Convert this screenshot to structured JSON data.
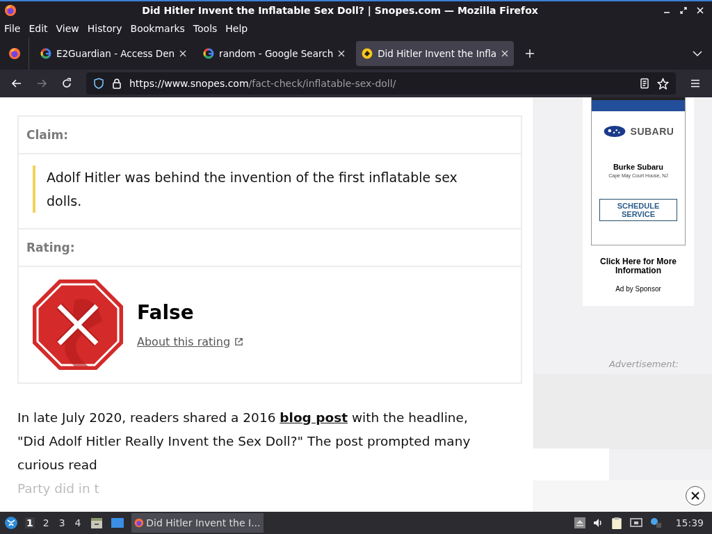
{
  "window": {
    "title": "Did Hitler Invent the Inflatable Sex Doll? | Snopes.com — Mozilla Firefox"
  },
  "menu": [
    "File",
    "Edit",
    "View",
    "History",
    "Bookmarks",
    "Tools",
    "Help"
  ],
  "tabs": [
    {
      "label": "E2Guardian - Access Den",
      "selected": false,
      "kind": "google"
    },
    {
      "label": "random - Google Search",
      "selected": false,
      "kind": "google"
    },
    {
      "label": "Did Hitler Invent the Infla",
      "selected": true,
      "kind": "snopes"
    }
  ],
  "address": {
    "host": "https://www.snopes.com",
    "path": "/fact-check/inflatable-sex-doll/"
  },
  "claim": {
    "heading": "Claim:",
    "text": "Adolf Hitler was behind the invention of the first inflatable sex dolls."
  },
  "rating": {
    "heading": "Rating:",
    "value": "False",
    "link": "About this rating"
  },
  "article": [
    {
      "text": "In late July 2020, readers shared a 2016 ",
      "link": "blog post",
      "after": " with the headline,",
      "faded": false
    },
    {
      "text": "\"Did Adolf Hitler Really Invent the Sex Doll?\" The post prompted many",
      "faded": false
    },
    {
      "text": "curious read",
      "faded": false
    },
    {
      "text": "Party did in t",
      "faded": true
    }
  ],
  "ad": {
    "brand": "SUBARU",
    "dealer": "Burke Subaru",
    "location": "Cape May Court House, NJ",
    "button": "SCHEDULE SERVICE",
    "more": "Click Here for More Information",
    "sponsor": "Ad by Sponsor",
    "label": "Advertisement:"
  },
  "taskbar": {
    "workspaces": [
      {
        "label": "1",
        "selected": true
      },
      {
        "label": "2",
        "selected": false
      },
      {
        "label": "3",
        "selected": false
      },
      {
        "label": "4",
        "selected": false
      }
    ],
    "task": "Did Hitler Invent the I...",
    "clock": "15:39"
  }
}
